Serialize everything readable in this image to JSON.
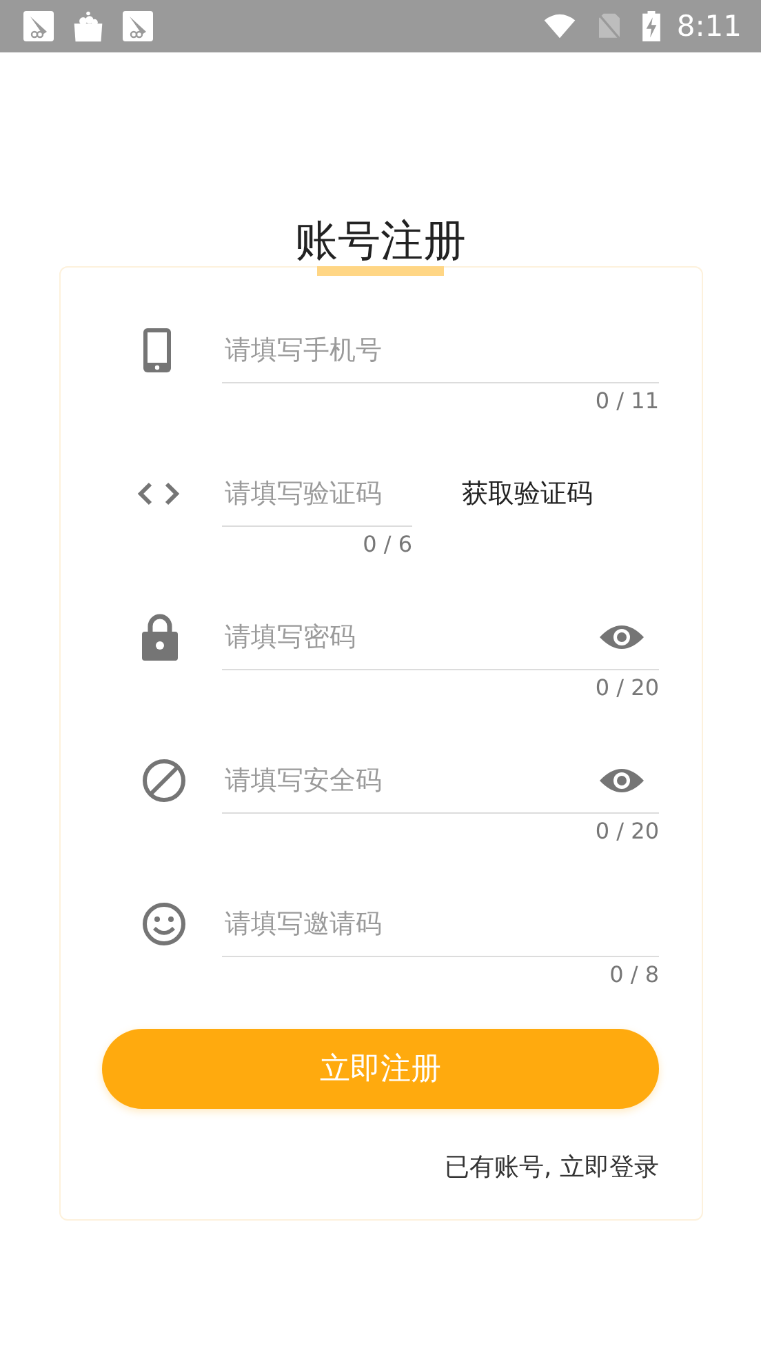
{
  "status_bar": {
    "time": "8:11"
  },
  "title": "账号注册",
  "fields": [
    {
      "kind": "phone",
      "placeholder": "请填写手机号",
      "counter": "0 / 11",
      "reveal_toggle": false
    },
    {
      "kind": "code",
      "placeholder": "请填写验证码",
      "counter": "0 / 6",
      "reveal_toggle": false,
      "action": "获取验证码"
    },
    {
      "kind": "password",
      "placeholder": "请填写密码",
      "counter": "0 / 20",
      "reveal_toggle": true
    },
    {
      "kind": "security",
      "placeholder": "请填写安全码",
      "counter": "0 / 20",
      "reveal_toggle": true
    },
    {
      "kind": "invite",
      "placeholder": "请填写邀请码",
      "counter": "0 / 8",
      "reveal_toggle": false
    }
  ],
  "submit": "立即注册",
  "login_link": "已有账号, 立即登录"
}
